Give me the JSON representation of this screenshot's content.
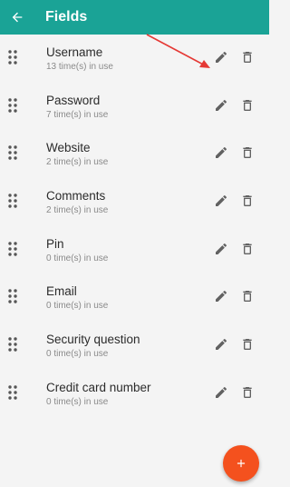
{
  "appbar": {
    "title": "Fields",
    "color": "#1aa396"
  },
  "fields": [
    {
      "name": "Username",
      "usage": "13 time(s) in use"
    },
    {
      "name": "Password",
      "usage": "7 time(s) in use"
    },
    {
      "name": "Website",
      "usage": "2 time(s) in use"
    },
    {
      "name": "Comments",
      "usage": "2 time(s) in use"
    },
    {
      "name": "Pin",
      "usage": "0 time(s) in use"
    },
    {
      "name": "Email",
      "usage": "0 time(s) in use"
    },
    {
      "name": "Security question",
      "usage": "0 time(s) in use"
    },
    {
      "name": "Credit card number",
      "usage": "0 time(s) in use"
    }
  ],
  "icons": {
    "back": "arrow-left-icon",
    "drag": "drag-handle-icon",
    "edit": "pencil-icon",
    "delete": "trash-icon",
    "add": "plus-icon"
  },
  "fab_color": "#f4511e",
  "annotation_color": "#e53935"
}
